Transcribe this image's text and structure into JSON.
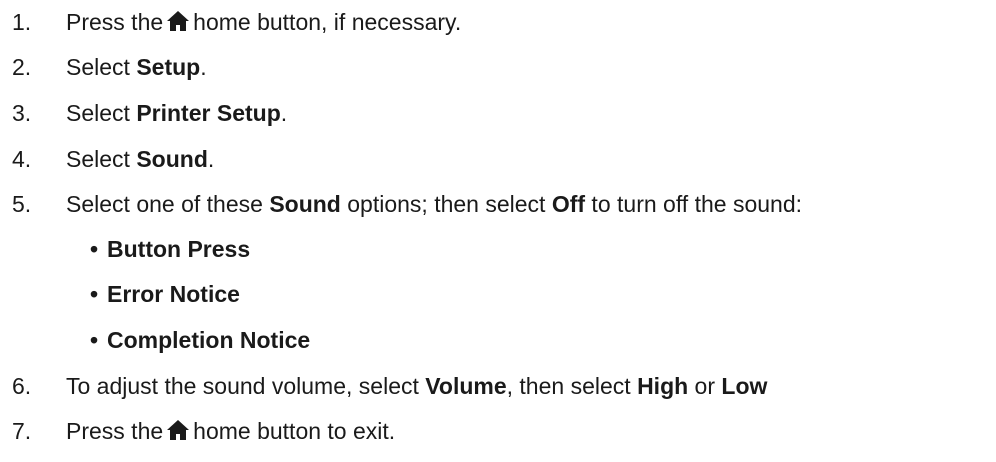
{
  "steps": [
    {
      "num": "1.",
      "pre": "Press the",
      "icon": "home-icon",
      "post": "home button, if necessary."
    },
    {
      "num": "2.",
      "pre": "Select ",
      "bold": "Setup",
      "post": "."
    },
    {
      "num": "3.",
      "pre": "Select ",
      "bold": "Printer Setup",
      "post": "."
    },
    {
      "num": "4.",
      "pre": "Select ",
      "bold": "Sound",
      "post": "."
    },
    {
      "num": "5.",
      "pre": "Select one of these ",
      "bold": "Sound",
      "mid": " options; then select ",
      "bold2": "Off",
      "post": " to turn off the sound:"
    },
    {
      "num": "6.",
      "pre": "To adjust the sound volume, select ",
      "bold": "Volume",
      "mid": ", then select ",
      "bold2": "High",
      "mid2": " or ",
      "bold3": "Low"
    },
    {
      "num": "7.",
      "pre": "Press the",
      "icon": "home-icon",
      "post": "home button to exit."
    }
  ],
  "sound_options": [
    {
      "bullet": "•",
      "label": "Button Press"
    },
    {
      "bullet": "•",
      "label": "Error Notice"
    },
    {
      "bullet": "•",
      "label": "Completion Notice"
    }
  ]
}
